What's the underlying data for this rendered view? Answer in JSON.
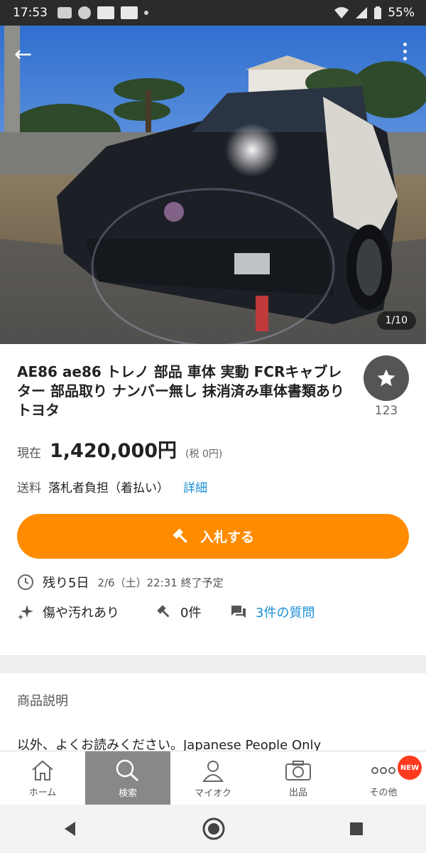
{
  "status_bar": {
    "time": "17:53",
    "battery": "55%"
  },
  "gallery": {
    "counter": "1/10"
  },
  "listing": {
    "title": "AE86 ae86 トレノ 部品 車体 実動 FCRキャブレター 部品取り ナンバー無し 抹消済み車体書類あり トヨタ",
    "watch_count": "123",
    "price_label": "現在",
    "price": "1,420,000円",
    "tax": "(税 0円)",
    "shipping_label": "送料",
    "shipping_value": "落札者負担（着払い）",
    "shipping_detail_link": "詳細",
    "bid_button": "入札する",
    "remaining": "残り5日",
    "end_time": "2/6（土）22:31 終了予定",
    "condition": "傷や汚れあり",
    "bids": "0件",
    "questions_link": "3件の質問"
  },
  "description": {
    "heading": "商品説明",
    "text": "以外、よくお読みください。Japanese People Only"
  },
  "tabbar": [
    {
      "label": "ホーム",
      "icon": "home-icon"
    },
    {
      "label": "検索",
      "icon": "search-icon",
      "active": true
    },
    {
      "label": "マイオク",
      "icon": "person-icon"
    },
    {
      "label": "出品",
      "icon": "camera-icon"
    },
    {
      "label": "その他",
      "icon": "more-icon",
      "badge": "NEW"
    }
  ],
  "colors": {
    "accent": "#ff8c00",
    "link": "#1a90d6",
    "badge": "#ff3b1f"
  }
}
